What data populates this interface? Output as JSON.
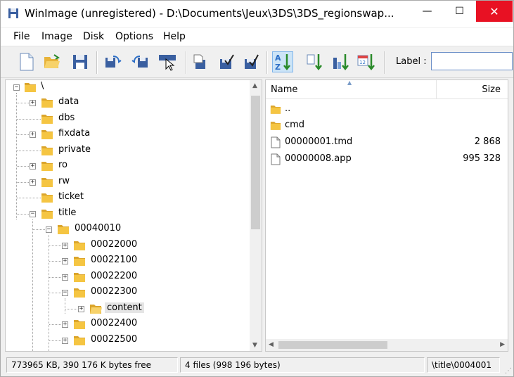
{
  "window": {
    "title": "WinImage (unregistered) - D:\\Documents\\Jeux\\3DS\\3DS_regionswap...",
    "controls": {
      "minimize": "—",
      "maximize": "☐",
      "close": "✕"
    }
  },
  "menu": {
    "items": [
      "File",
      "Image",
      "Disk",
      "Options",
      "Help"
    ]
  },
  "toolbar": {
    "buttons": [
      "new-image",
      "open-image",
      "save-image",
      "read-disk",
      "write-disk",
      "format-disk",
      "inject",
      "extract",
      "extract-path",
      "sort-by-name",
      "sort-by-extension",
      "sort-by-size",
      "sort-by-date"
    ],
    "label_text": "Label :",
    "label_value": ""
  },
  "tree": {
    "root": "\\",
    "items": [
      {
        "label": "data",
        "expander": "+"
      },
      {
        "label": "dbs",
        "expander": ""
      },
      {
        "label": "fixdata",
        "expander": "+"
      },
      {
        "label": "private",
        "expander": ""
      },
      {
        "label": "ro",
        "expander": "+"
      },
      {
        "label": "rw",
        "expander": "+"
      },
      {
        "label": "ticket",
        "expander": ""
      },
      {
        "label": "title",
        "expander": "−"
      },
      {
        "label": "00040010",
        "expander": "−"
      },
      {
        "label": "00022000",
        "expander": "+"
      },
      {
        "label": "00022100",
        "expander": "+"
      },
      {
        "label": "00022200",
        "expander": "+"
      },
      {
        "label": "00022300",
        "expander": "−"
      },
      {
        "label": "content",
        "expander": "+"
      },
      {
        "label": "00022400",
        "expander": "+"
      },
      {
        "label": "00022500",
        "expander": "+"
      }
    ]
  },
  "list": {
    "columns": {
      "name": "Name",
      "size": "Size"
    },
    "rows": [
      {
        "name": "..",
        "size": "",
        "type": "folder"
      },
      {
        "name": "cmd",
        "size": "",
        "type": "folder"
      },
      {
        "name": "00000001.tmd",
        "size": "2 868",
        "type": "file"
      },
      {
        "name": "00000008.app",
        "size": "995 328",
        "type": "file"
      }
    ]
  },
  "status": {
    "left": "773965 KB, 390 176 K bytes free",
    "middle": "4 files (998 196 bytes)",
    "right": "\\title\\0004001"
  },
  "colors": {
    "close_button": "#e81123",
    "folder": "#f5c542",
    "selection": "#e5e5e5"
  }
}
